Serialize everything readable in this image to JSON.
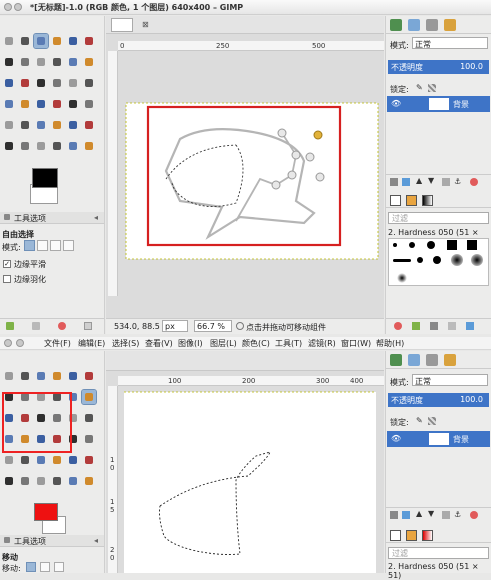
{
  "top_window": {
    "title": "*[无标题]-1.0 (RGB 颜色, 1 个图层) 640x400 – GIMP",
    "ruler_marks": [
      "0",
      "250",
      "500"
    ],
    "status": {
      "coords": "534.0, 88.5",
      "unit": "px",
      "zoom": "66.7 %",
      "hint": "点击并拖动可移动组件"
    }
  },
  "bottom_window": {
    "menus": [
      "文件(F)",
      "编辑(E)",
      "选择(S)",
      "查看(V)",
      "图像(I)",
      "图层(L)",
      "颜色(C)",
      "工具(T)",
      "滤镜(R)",
      "窗口(W)",
      "帮助(H)"
    ],
    "ruler_marks": [
      "100",
      "200",
      "300",
      "400"
    ],
    "vruler_marks": [
      "1",
      "0",
      "1",
      "5",
      "2",
      "0"
    ]
  },
  "toolbox_top": {
    "fg_color": "#000000",
    "bg_color": "#ffffff",
    "tab_label": "工具选项",
    "tool_name": "自由选择",
    "mode_label": "模式:",
    "antialias_label": "边缘平滑",
    "antialias_checked": true,
    "feather_label": "边缘羽化",
    "feather_checked": false
  },
  "toolbox_bottom": {
    "fg_color": "#ee1111",
    "bg_color": "#ffffff",
    "tab_label": "工具选项",
    "tool_name": "移动",
    "move_label": "移动:"
  },
  "layers_top": {
    "mode_label": "模式:",
    "mode_value": "正常",
    "opacity_label": "不透明度",
    "opacity_value": "100.0",
    "lock_label": "锁定:",
    "layer_name": "背景"
  },
  "layers_bottom": {
    "mode_label": "模式:",
    "mode_value": "正常",
    "opacity_label": "不透明度",
    "opacity_value": "100.0",
    "lock_label": "锁定:",
    "layer_name": "背景"
  },
  "brushes": {
    "filter_placeholder": "过滤",
    "brush_name": "2. Hardness 050 (51 × 51)"
  },
  "colors": {
    "selection_highlight": "#ee2222",
    "frame_red": "#d62020",
    "active_layer": "#3e74c7"
  }
}
